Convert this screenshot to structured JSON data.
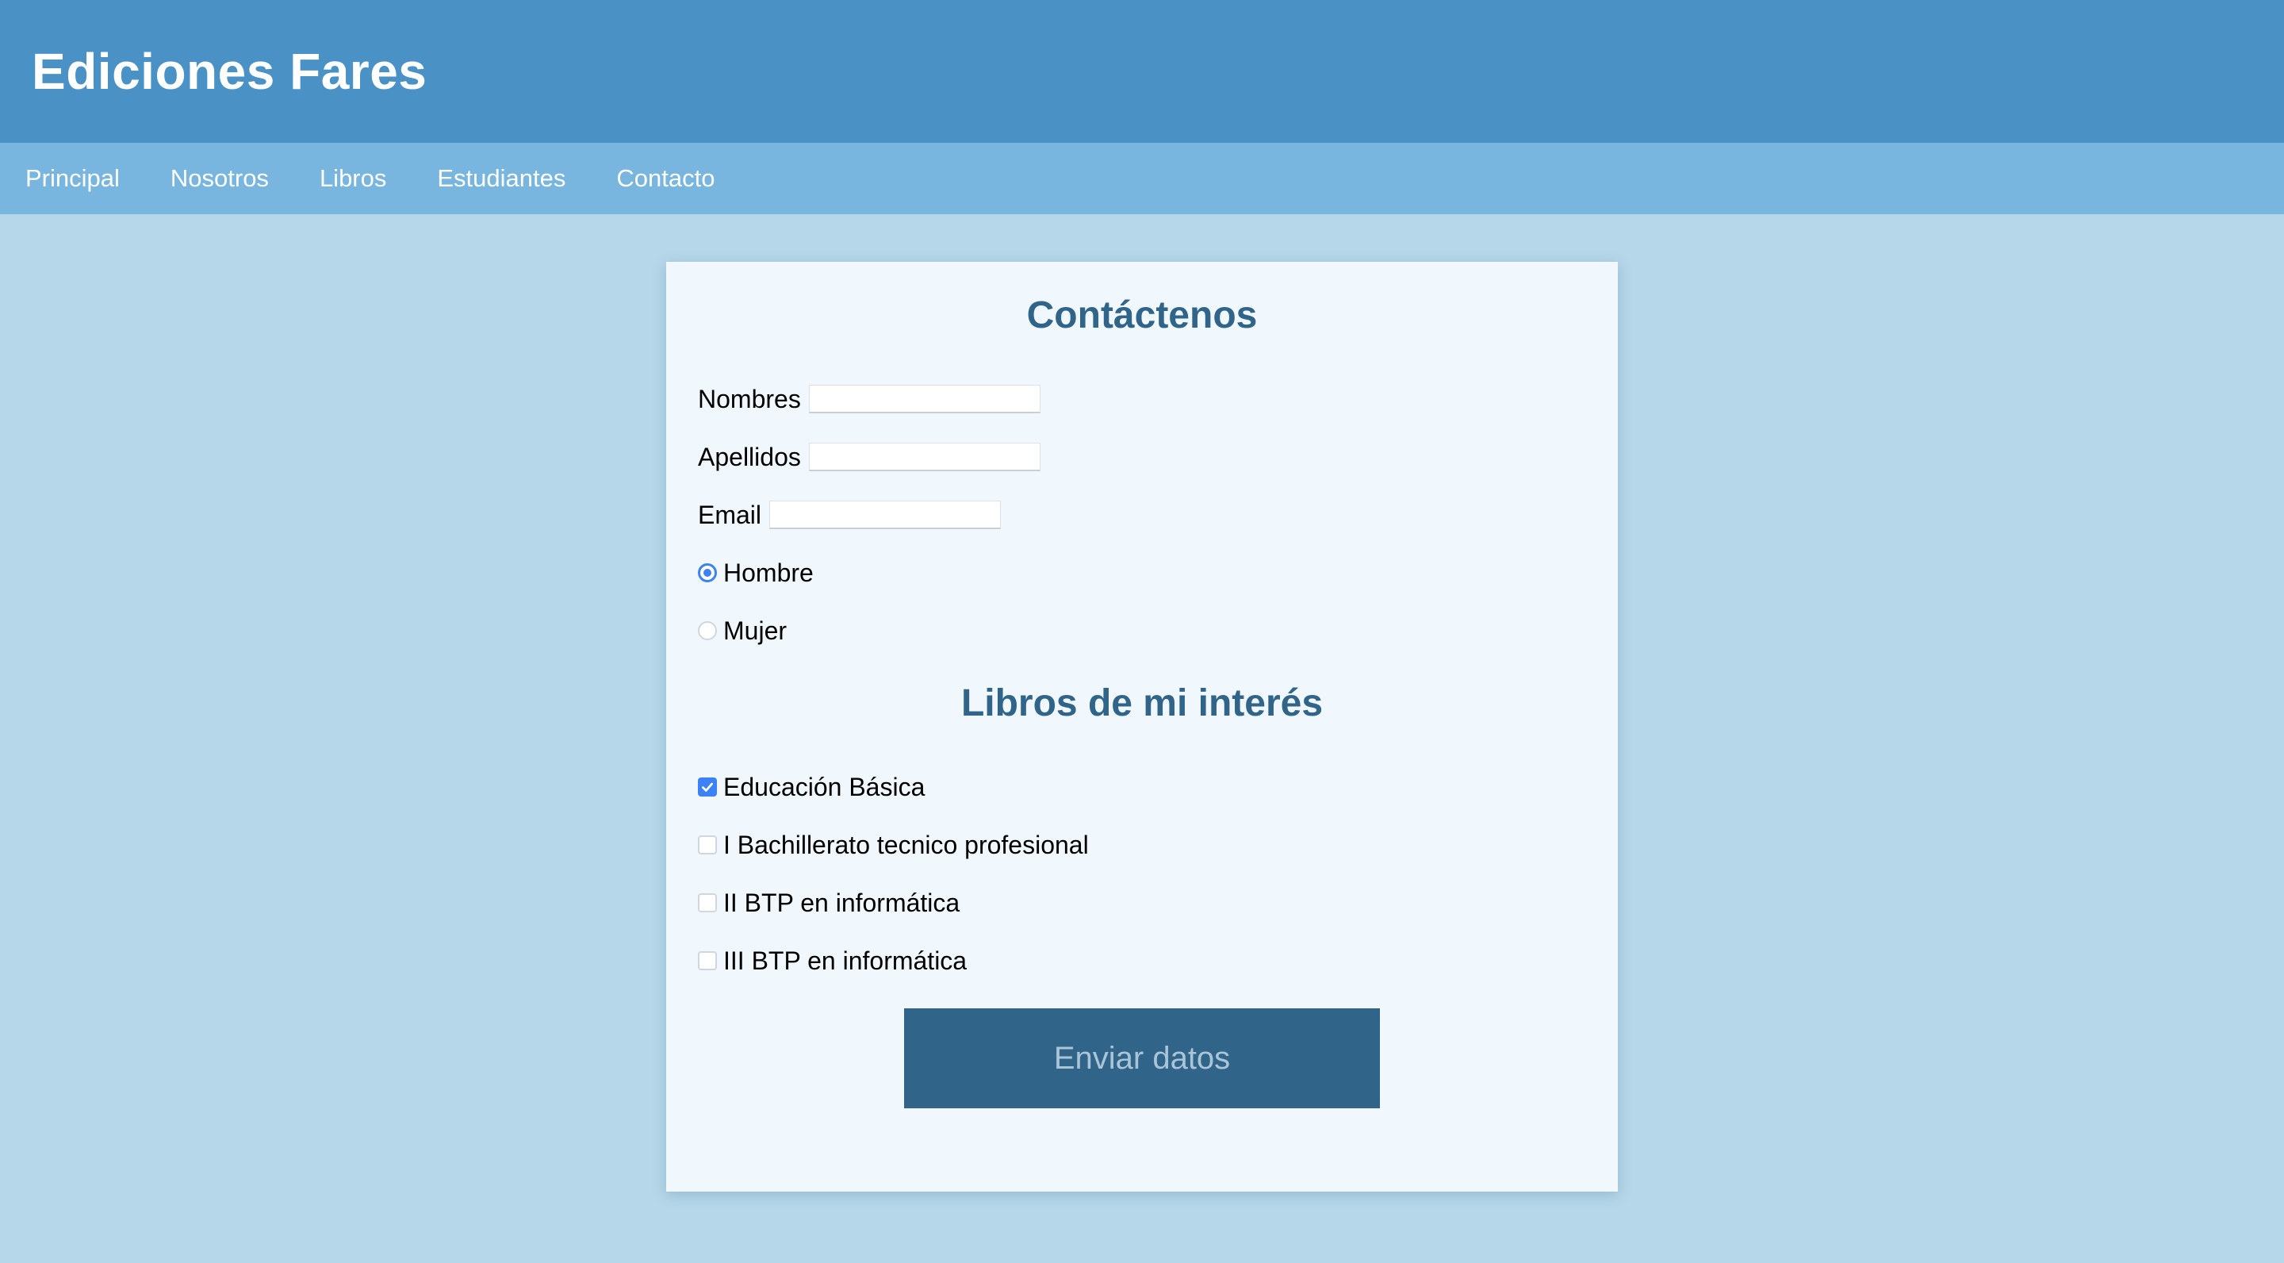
{
  "site": {
    "title": "Ediciones Fares"
  },
  "nav": {
    "items": [
      {
        "label": "Principal"
      },
      {
        "label": "Nosotros"
      },
      {
        "label": "Libros"
      },
      {
        "label": "Estudiantes"
      },
      {
        "label": "Contacto"
      }
    ]
  },
  "form": {
    "title": "Contáctenos",
    "fields": {
      "nombres": {
        "label": "Nombres",
        "value": ""
      },
      "apellidos": {
        "label": "Apellidos",
        "value": ""
      },
      "email": {
        "label": "Email",
        "value": ""
      }
    },
    "gender": {
      "options": [
        {
          "label": "Hombre",
          "checked": true
        },
        {
          "label": "Mujer",
          "checked": false
        }
      ]
    },
    "books_title": "Libros de mi interés",
    "books": [
      {
        "label": "Educación Básica",
        "checked": true
      },
      {
        "label": "I Bachillerato tecnico profesional",
        "checked": false
      },
      {
        "label": "II BTP en informática",
        "checked": false
      },
      {
        "label": "III BTP en informática",
        "checked": false
      }
    ],
    "submit_label": "Enviar datos"
  },
  "colors": {
    "header": "#4a91c5",
    "nav": "#78b6e0",
    "background": "#b5d7e9",
    "card": "#f0f7fd",
    "heading": "#316489",
    "accent": "#3b82f6",
    "button": "#316489"
  }
}
